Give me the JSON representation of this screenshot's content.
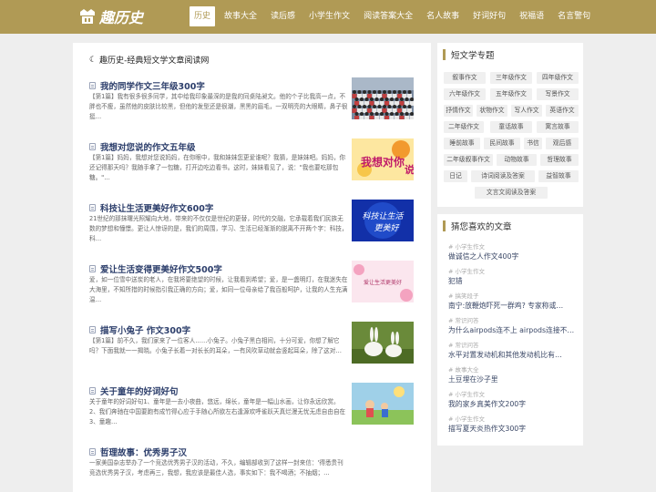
{
  "site": {
    "logo_text": "趣历史"
  },
  "nav": [
    "首页",
    "历史",
    "故事大全",
    "读后感",
    "小学生作文",
    "阅读答案大全",
    "名人故事",
    "好词好句",
    "祝福语",
    "名言警句"
  ],
  "nav_active": "历史",
  "main": {
    "heading": "趣历史-经典短文学文章阅读网",
    "articles": [
      {
        "title": "我的同学作文三年级300字",
        "summary": "【第1篇】我有很多很多同学，其中给我印象最深的是我的同桌陆昶文。他的个子比我高一点，不胖也不瘦，虽然他的皮肤比较黑，但他的发型还是很潮，黑黑的眉毛，一双明亮的大眼睛，鼻子很挺…",
        "thumb": "crowd"
      },
      {
        "title": "我想对您说的作文五年级",
        "summary": "【第1篇】妈妈，我想对您说妈妈，在你眼中，我和妹妹您更爱谁呢？我猜，是妹妹吧。妈妈，你还记得那天吗？我随手拿了一包糖，打开边吃边看书。这时，妹妹看见了，说：\"我也要吃那包糖。\"…",
        "thumb": "say"
      },
      {
        "title": "科技让生活更美好作文600字",
        "summary": "21世纪的那抹曙光照耀向大地，带来的不仅仅是世纪的更替，时代的交融，它承载着我们民族无数的梦想和憧憬。更让人惊讶的是，我们的周围，学习、生活已经渐渐的脱离不开两个字：科技，科…",
        "thumb": "tech"
      },
      {
        "title": "爱让生活变得更美好作文500字",
        "summary": "爱，如一位雪中送炭的老人，在我将要绝望的时候，让我看到希望；爱，是一盏明灯，在我迷失在大海里，不知所措的时候指引我正确的方向；爱，如同一位母亲给了我百般呵护，让我的人生充满温…",
        "thumb": "love"
      },
      {
        "title": "描写小兔子 作文300字",
        "summary": "【第1篇】前不久，我们家来了一位客人……小兔子。小兔子黑白相间，十分可爱，你想了解它吗？下面我就一一揭晓。小兔子长着一对长长的耳朵，一有风吹草动就会竖起耳朵，除了这对…",
        "thumb": "rabbit"
      },
      {
        "title": "关于童年的好词好句",
        "summary": "关于童年的好词好句1、童年是一去小夜曲，悠远，绵长，童年是一幅山水画，让你永远欣赏。2、我们奔驰在中国要跑有成竹得心应于手随心所欲左右逢源欢呼雀跃天真烂漫无忧无虑自由自在3、童趣…",
        "thumb": "child"
      },
      {
        "title": "哲理故事：优秀男子汉",
        "summary": "一家美国杂志举办了一个竞选优秀男子汉的活动，不久，编辑部收到了这样一封来信：'得悉贵刊竞选优秀男子汉，考虑再三，我想，我应该是最佳人选，事实如下：我不喝酒；不抽烟；…",
        "thumb": ""
      }
    ]
  },
  "side_topics": {
    "title": "短文学专题",
    "tags": [
      "叙事作文",
      "三年级作文",
      "四年级作文",
      "六年级作文",
      "五年级作文",
      "写景作文",
      "抒情作文",
      "状物作文",
      "写人作文",
      "英语作文",
      "二年级作文",
      "童话故事",
      "寓言故事",
      "睡前故事",
      "民间故事",
      "书信",
      "观后感",
      "二年级叙事作文",
      "动物故事",
      "哲理故事",
      "日记",
      "诗词阅读及答案",
      "益智故事",
      "文言文阅读及答案"
    ]
  },
  "side_recommend": {
    "title": "猜您喜欢的文章",
    "items": [
      {
        "cat": "# 小学生作文",
        "title": "做诚信之人作文400字"
      },
      {
        "cat": "# 小学生作文",
        "title": "犯错"
      },
      {
        "cat": "# 搞笑段子",
        "title": "南宁:放鞭炮吓死一群鸡? 专家称或…"
      },
      {
        "cat": "# 常识问答",
        "title": "为什么airpods连不上 airpods连接不…"
      },
      {
        "cat": "# 常识问答",
        "title": "水平对置发动机和其他发动机比有…"
      },
      {
        "cat": "# 故事大全",
        "title": "土豆埋在沙子里"
      },
      {
        "cat": "# 小学生作文",
        "title": "我的家乡真美作文200字"
      },
      {
        "cat": "# 小学生作文",
        "title": "描写夏天炎热作文300字"
      }
    ]
  }
}
